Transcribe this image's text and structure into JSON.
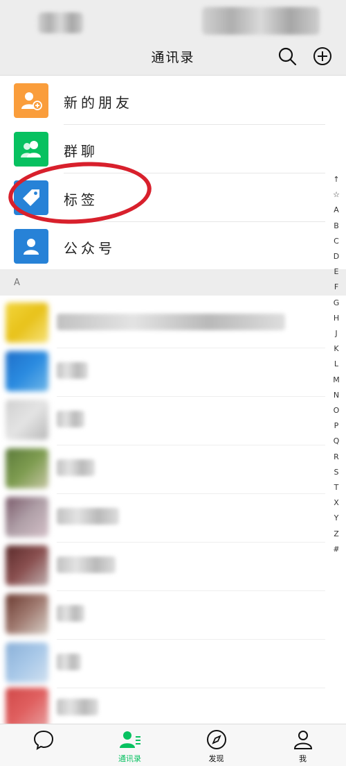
{
  "header": {
    "title": "通讯录"
  },
  "menu": [
    {
      "label": "新的朋友",
      "color": "#fa9d3b",
      "icon": "add-friend-icon"
    },
    {
      "label": "群聊",
      "color": "#07c160",
      "icon": "group-chat-icon"
    },
    {
      "label": "标签",
      "color": "#2782d7",
      "icon": "tag-icon"
    },
    {
      "label": "公众号",
      "color": "#2782d7",
      "icon": "official-account-icon"
    }
  ],
  "section": {
    "letter": "A"
  },
  "index_bar": [
    "↑",
    "☆",
    "A",
    "B",
    "C",
    "D",
    "E",
    "F",
    "G",
    "H",
    "J",
    "K",
    "L",
    "M",
    "N",
    "O",
    "P",
    "Q",
    "R",
    "S",
    "T",
    "X",
    "Y",
    "Z",
    "#"
  ],
  "tabs": [
    {
      "label": "",
      "icon": "chat-bubble-icon",
      "active": false
    },
    {
      "label": "通讯录",
      "icon": "contacts-icon",
      "active": true
    },
    {
      "label": "发现",
      "icon": "compass-icon",
      "active": false
    },
    {
      "label": "我",
      "icon": "person-icon",
      "active": false
    }
  ],
  "colors": {
    "accent": "#07c160",
    "annotation": "#d8202c",
    "background": "#ededed"
  }
}
